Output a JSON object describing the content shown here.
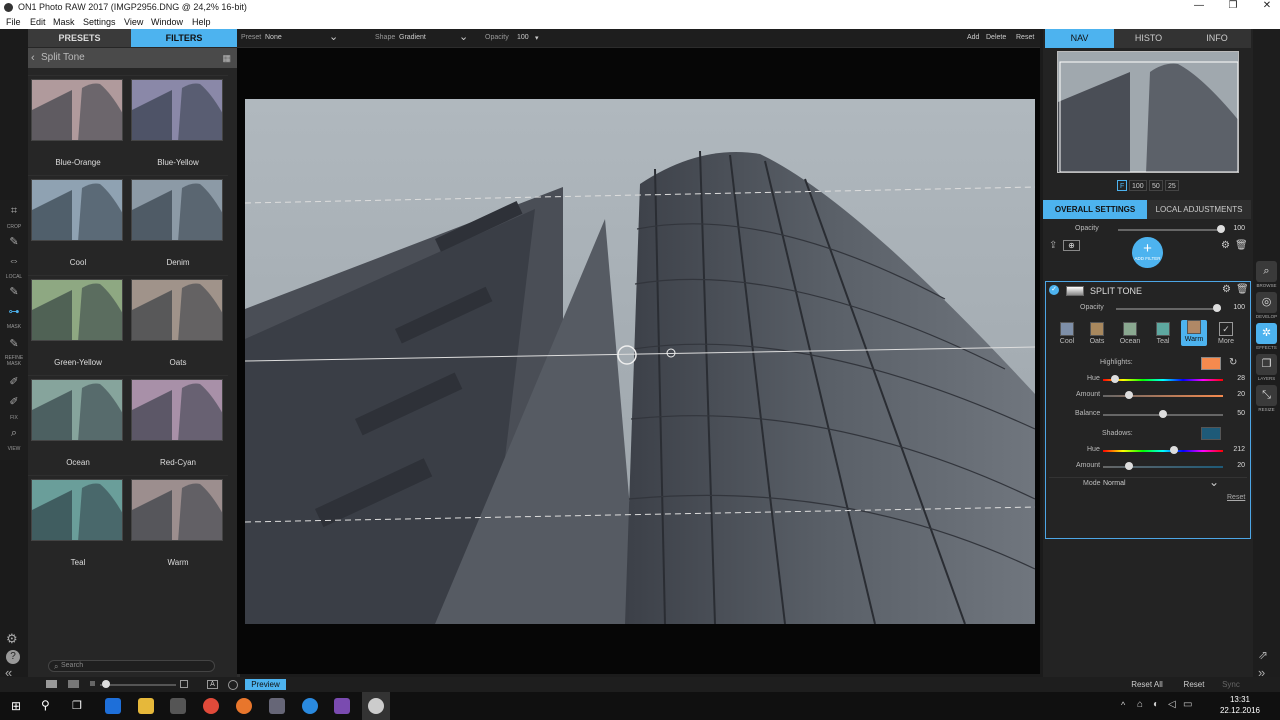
{
  "window": {
    "title": "ON1 Photo RAW 2017 (IMGP2956.DNG @ 24,2% 16-bit)",
    "minimize_symbol": "—",
    "maximize_symbol": "❐",
    "close_symbol": "✕"
  },
  "menu": [
    "File",
    "Edit",
    "Mask",
    "Settings",
    "View",
    "Window",
    "Help"
  ],
  "left_panel": {
    "tabs": [
      "PRESETS",
      "FILTERS"
    ],
    "active_tab": "FILTERS",
    "breadcrumb": "Split Tone",
    "presets": [
      {
        "label": "Blue-Orange",
        "color": "#b09a9c"
      },
      {
        "label": "Blue-Yellow",
        "color": "#8a88a8"
      },
      {
        "label": "Cool",
        "color": "#8fa2b2"
      },
      {
        "label": "Denim",
        "color": "#8c9aa6"
      },
      {
        "label": "Green-Yellow",
        "color": "#8ea882"
      },
      {
        "label": "Oats",
        "color": "#a0938a"
      },
      {
        "label": "Ocean",
        "color": "#86a49c"
      },
      {
        "label": "Red-Cyan",
        "color": "#a890a8"
      },
      {
        "label": "Teal",
        "color": "#6a9e9a"
      },
      {
        "label": "Warm",
        "color": "#9c8e8e"
      }
    ],
    "search_placeholder": "Search"
  },
  "tools": [
    {
      "name": "crop",
      "label": "CROP"
    },
    {
      "name": "local",
      "label": "LOCAL"
    },
    {
      "name": "mask",
      "label": "MASK"
    },
    {
      "name": "refine",
      "label": "REFINE MASK"
    },
    {
      "name": "fix",
      "label": "FIX"
    },
    {
      "name": "view",
      "label": "VIEW"
    }
  ],
  "options_bar": {
    "preset_label": "Preset",
    "preset_value": "None",
    "shape_label": "Shape",
    "shape_value": "Gradient",
    "opacity_label": "Opacity",
    "opacity_value": "100",
    "add": "Add",
    "delete": "Delete",
    "reset": "Reset"
  },
  "right_panel": {
    "tabs": [
      "NAV",
      "HISTO",
      "INFO"
    ],
    "active_tab": "NAV",
    "zoom_options": [
      "F",
      "100",
      "50",
      "25"
    ],
    "settings_tabs": [
      "OVERALL SETTINGS",
      "LOCAL ADJUSTMENTS"
    ],
    "overall_opacity_label": "Opacity",
    "overall_opacity_value": "100",
    "add_filter_label": "ADD FILTER",
    "filter": {
      "title": "SPLIT TONE",
      "opacity_label": "Opacity",
      "opacity_value": "100",
      "presets": [
        {
          "label": "Cool",
          "color": "#7e8fa8"
        },
        {
          "label": "Oats",
          "color": "#a8885e"
        },
        {
          "label": "Ocean",
          "color": "#8aa890"
        },
        {
          "label": "Teal",
          "color": "#5ea8a0"
        },
        {
          "label": "Warm",
          "color": "#b08866"
        },
        {
          "label": "More",
          "color": ""
        }
      ],
      "active_preset": "Warm",
      "highlights_label": "Highlights:",
      "highlights_color": "#f58a4e",
      "hue_label": "Hue",
      "highlight_hue": "28",
      "amount_label": "Amount",
      "highlight_amount": "20",
      "balance_label": "Balance",
      "balance": "50",
      "shadows_label": "Shadows:",
      "shadows_color": "#1e5a78",
      "shadow_hue": "212",
      "shadow_amount": "20",
      "mode_label": "Mode",
      "mode_value": "Normal",
      "reset": "Reset"
    }
  },
  "right_tools": [
    {
      "name": "browse",
      "label": "BROWSE"
    },
    {
      "name": "develop",
      "label": "DEVELOP"
    },
    {
      "name": "effects",
      "label": "EFFECTS"
    },
    {
      "name": "layers",
      "label": "LAYERS"
    },
    {
      "name": "resize",
      "label": "RESIZE"
    }
  ],
  "bottom": {
    "preview": "Preview",
    "reset_all": "Reset All",
    "reset": "Reset",
    "sync": "Sync"
  },
  "taskbar": {
    "time": "13:31",
    "date": "22.12.2016"
  },
  "colors": {
    "accent": "#4db3ef"
  }
}
